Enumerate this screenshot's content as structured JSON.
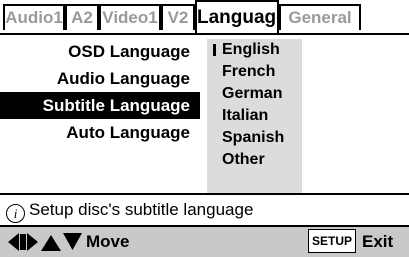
{
  "tabs": {
    "audio1": "Audio1",
    "a2": "A2",
    "video1": "Video1",
    "v2": "V2",
    "language": "Language",
    "general": "General",
    "active": "Language"
  },
  "menu": {
    "items": [
      {
        "label": "OSD Language",
        "selected": false
      },
      {
        "label": "Audio Language",
        "selected": false
      },
      {
        "label": "Subtitle Language",
        "selected": true
      },
      {
        "label": "Auto Language",
        "selected": false
      }
    ]
  },
  "options": {
    "items": [
      {
        "label": "English",
        "current": true
      },
      {
        "label": "French",
        "current": false
      },
      {
        "label": "German",
        "current": false
      },
      {
        "label": "Italian",
        "current": false
      },
      {
        "label": "Spanish",
        "current": false
      },
      {
        "label": "Other",
        "current": false
      }
    ]
  },
  "help": {
    "icon": "info-icon",
    "text": "Setup disc's subtitle language"
  },
  "bottom_bar": {
    "arrows_icon": "arrow-keys-icon",
    "move_label": "Move",
    "setup_button": "SETUP",
    "exit_label": "Exit"
  },
  "colors": {
    "selected_bg": "#000000",
    "options_bg": "#dcdcdc",
    "bottom_bg": "#c9c9c9",
    "inactive_tab": "#9a9a9a"
  }
}
